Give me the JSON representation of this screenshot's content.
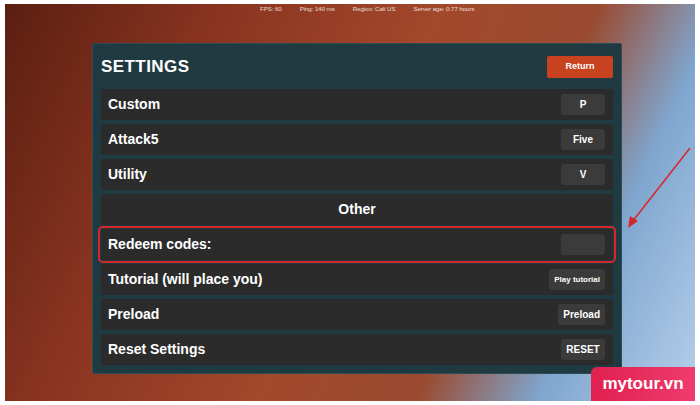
{
  "hud": [
    "FPS: 60",
    "Ping: 140 ms",
    "Region: Cali US",
    "Server age: 0.77 hours"
  ],
  "panel": {
    "title": "SETTINGS",
    "return_button": "Return"
  },
  "rows": [
    {
      "kind": "key",
      "label": "Custom",
      "button": "P",
      "highlighted": false
    },
    {
      "kind": "key",
      "label": "Attack5",
      "button": "Five",
      "highlighted": false
    },
    {
      "kind": "key",
      "label": "Utility",
      "button": "V",
      "highlighted": false
    },
    {
      "kind": "header",
      "label": "Other",
      "highlighted": false
    },
    {
      "kind": "input",
      "label": "Redeem codes:",
      "highlighted": true
    },
    {
      "kind": "key",
      "label": "Tutorial (will place you)",
      "button": "Play tutorial",
      "highlighted": false
    },
    {
      "kind": "key",
      "label": "Preload",
      "button": "Preload",
      "highlighted": false
    },
    {
      "kind": "key",
      "label": "Reset Settings",
      "button": "RESET",
      "highlighted": false
    }
  ],
  "watermark": "mytour.vn"
}
